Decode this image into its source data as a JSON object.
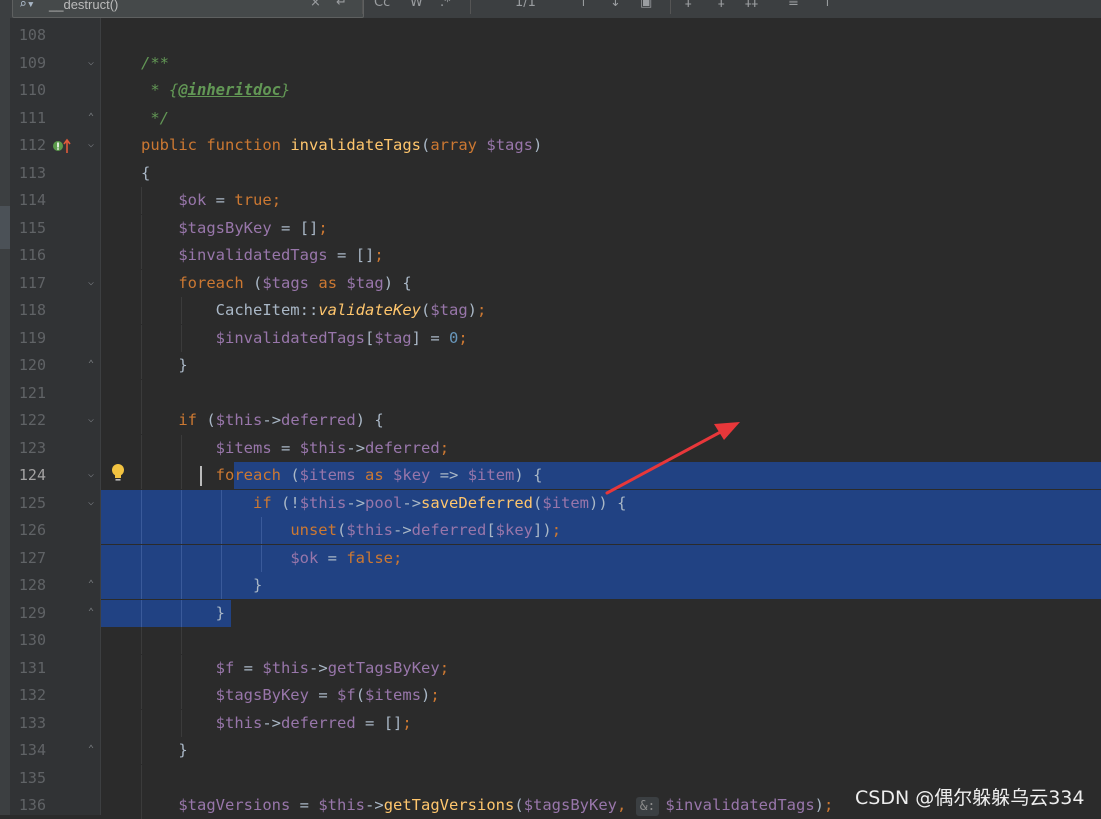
{
  "toolbar": {
    "search_query": "__destruct()",
    "match_count": "1/1"
  },
  "editor": {
    "active_line": 124,
    "lines": [
      {
        "n": "108",
        "code": ""
      },
      {
        "n": "109",
        "code": "/**"
      },
      {
        "n": "110",
        "code": " * {@inheritdoc}"
      },
      {
        "n": "111",
        "code": " */"
      },
      {
        "n": "112",
        "code": "public function invalidateTags(array $tags)"
      },
      {
        "n": "113",
        "code": "{"
      },
      {
        "n": "114",
        "code": "    $ok = true;"
      },
      {
        "n": "115",
        "code": "    $tagsByKey = [];"
      },
      {
        "n": "116",
        "code": "    $invalidatedTags = [];"
      },
      {
        "n": "117",
        "code": "    foreach ($tags as $tag) {"
      },
      {
        "n": "118",
        "code": "        CacheItem::validateKey($tag);"
      },
      {
        "n": "119",
        "code": "        $invalidatedTags[$tag] = 0;"
      },
      {
        "n": "120",
        "code": "    }"
      },
      {
        "n": "121",
        "code": ""
      },
      {
        "n": "122",
        "code": "    if ($this->deferred) {"
      },
      {
        "n": "123",
        "code": "        $items = $this->deferred;"
      },
      {
        "n": "124",
        "code": "        foreach ($items as $key => $item) {"
      },
      {
        "n": "125",
        "code": "            if (!$this->pool->saveDeferred($item)) {"
      },
      {
        "n": "126",
        "code": "                unset($this->deferred[$key]);"
      },
      {
        "n": "127",
        "code": "                $ok = false;"
      },
      {
        "n": "128",
        "code": "            }"
      },
      {
        "n": "129",
        "code": "        }"
      },
      {
        "n": "130",
        "code": ""
      },
      {
        "n": "131",
        "code": "        $f = $this->getTagsByKey;"
      },
      {
        "n": "132",
        "code": "        $tagsByKey = $f($items);"
      },
      {
        "n": "133",
        "code": "        $this->deferred = [];"
      },
      {
        "n": "134",
        "code": "    }"
      },
      {
        "n": "135",
        "code": ""
      },
      {
        "n": "136",
        "code": "    $tagVersions = $this->getTagVersions($tagsByKey, &: $invalidatedTags);"
      }
    ],
    "param_hint": "&:"
  },
  "watermark": "CSDN @偶尔躲躲乌云334",
  "colors": {
    "background": "#2b2b2b",
    "gutter": "#313335",
    "selection": "#214283",
    "keyword": "#cc7832",
    "variable": "#9876aa",
    "function": "#ffc66d",
    "comment": "#629755",
    "number": "#6897bb",
    "plain": "#a9b7c6",
    "annotation_arrow": "#e8373a"
  },
  "icons": [
    "search-icon",
    "close-icon",
    "regex-icon",
    "lightbulb-icon",
    "implements-marker-icon",
    "fold-icon"
  ]
}
